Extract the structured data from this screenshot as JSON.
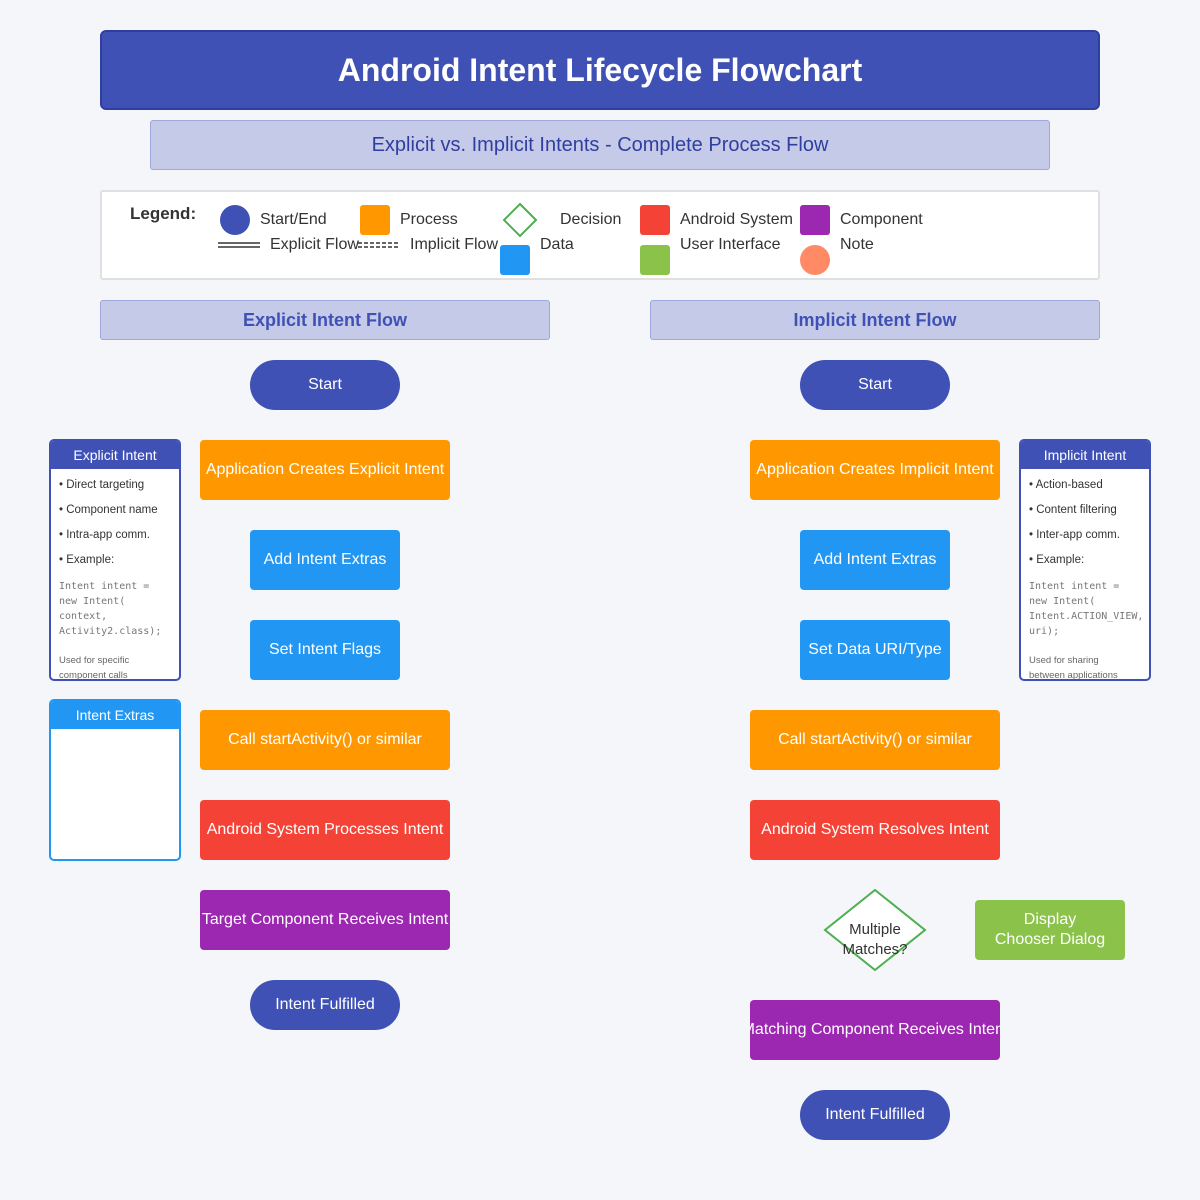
{
  "title": "Android Intent Lifecycle Flowchart",
  "subtitle": "Explicit vs. Implicit Intents - Complete Process Flow",
  "legend": {
    "title": "Legend:",
    "items": {
      "start_end": "Start/End",
      "process": "Process",
      "decision": "Decision",
      "android_system": "Android System",
      "component": "Component",
      "explicit_flow": "Explicit Flow",
      "implicit_flow": "Implicit Flow",
      "data": "Data",
      "user_interface": "User Interface",
      "note": "Note"
    }
  },
  "colors": {
    "start_end": "#3f51b5",
    "process": "#ff9800",
    "decision": "#4caf50",
    "android_system": "#f44336",
    "component": "#9c27b0",
    "data": "#2196f3",
    "user_interface": "#8bc34a",
    "note": "#ff8a65"
  },
  "explicit": {
    "header": "Explicit Intent Flow",
    "start": "Start",
    "create": "Application Creates Explicit Intent",
    "extras": "Add Intent Extras",
    "flags": "Set Intent Flags",
    "call": "Call startActivity() or similar",
    "system": "Android System Processes Intent",
    "target": "Target Component Receives Intent",
    "end": "Intent Fulfilled"
  },
  "implicit": {
    "header": "Implicit Intent Flow",
    "start": "Start",
    "create": "Application Creates Implicit Intent",
    "extras": "Add Intent Extras",
    "data_uri": "Set Data URI/Type",
    "call": "Call startActivity() or similar",
    "system": "Android System Resolves Intent",
    "decision_line1": "Multiple",
    "decision_line2": "Matches?",
    "chooser_line1": "Display",
    "chooser_line2": "Chooser Dialog",
    "matching": "Matching Component Receives Intent",
    "end": "Intent Fulfilled"
  },
  "explicit_panel": {
    "title": "Explicit Intent",
    "items": [
      "• Direct targeting",
      "• Component name",
      "• Intra-app comm.",
      "• Example:"
    ],
    "code": [
      "Intent intent =",
      "new Intent(",
      "context,",
      "Activity2.class);"
    ],
    "note_lines": [
      "Used for specific",
      "component calls"
    ]
  },
  "implicit_panel": {
    "title": "Implicit Intent",
    "items": [
      "• Action-based",
      "• Content filtering",
      "• Inter-app comm.",
      "• Example:"
    ],
    "code": [
      "Intent intent =",
      "new Intent(",
      "Intent.ACTION_VIEW,",
      "uri);"
    ],
    "note_lines": [
      "Used for sharing",
      "between applications"
    ]
  },
  "extras_panel": {
    "title": "Intent Extras"
  }
}
